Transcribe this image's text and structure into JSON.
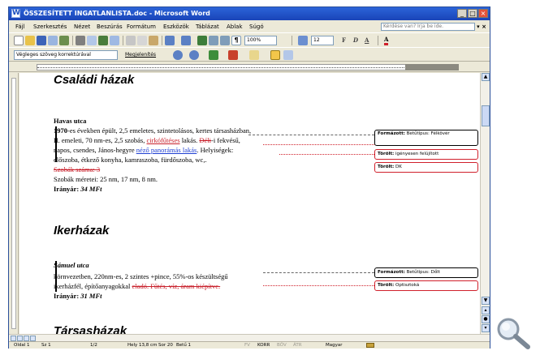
{
  "window": {
    "title": "ÖSSZESÍTETT INGATLANLISTA.doc - Microsoft Word",
    "min": "_",
    "max": "□",
    "close": "×"
  },
  "menu": {
    "items": [
      "Fájl",
      "Szerkesztés",
      "Nézet",
      "Beszúrás",
      "Formátum",
      "Eszközök",
      "Táblázat",
      "Ablak",
      "Súgó"
    ],
    "help_placeholder": "Kérdése van? Írja be ide.",
    "close_doc": "▾ ×"
  },
  "toolbar": {
    "zoom": "100%",
    "font_size": "12",
    "bold": "F",
    "italic": "D",
    "underline": "A",
    "font_color_letter": "A"
  },
  "reviewing": {
    "display_mode": "Végleges szöveg korrektúrával",
    "show_label": "Megjelenítés"
  },
  "document": {
    "heading1": "Családi házak",
    "h1_street": "Havas utca",
    "p1_year": "1970",
    "p1_rest": "-es években épült, 2,5 emeletes, szintetolásos, kertes társasházban,",
    "p2_a": "II. emeleti, 70 nm-es, 2,5 szobás, ",
    "p2_ins": "cirkófűtéses",
    "p2_b": " lakás. ",
    "p2_del": "Déli",
    "p2_c": "-i fekvésű,",
    "p3_a": "napos, csendes, János-hegyre ",
    "p3_link": "néző panorámás lakás",
    "p3_b": ". Helyiségek:",
    "p4": "előszoba, étkező konyha, kamraszoba, fürdőszoba, wc,.",
    "p5_del": "Szobák száma: 3",
    "p6": "Szobák méretei: 25 nm, 17 nm, 8 nm.",
    "p7_label": "Irányár: ",
    "p7_value": "34 MFt",
    "heading2": "Ikerházak",
    "h2_street": "Sámuel utca",
    "q1": "körnvezetben, 220nm-es, 2 szintes +pince, 55%-os készültségű",
    "q2_a": "ikerházfél, építőanyagokkal ",
    "q2_del": "eladó. Fűtés, víz, áram kiépítve.",
    "q3_label": "Irányár: ",
    "q3_value": "31 MFt",
    "heading3": "Társasházak"
  },
  "balloons": [
    {
      "label": "Formázott:",
      "text": "Betűtípus: Félkövér"
    },
    {
      "label": "Törölt:",
      "text": "igényesen felújított"
    },
    {
      "label": "Törölt:",
      "text": "DK"
    },
    {
      "label": "Formázott:",
      "text": "Betűtípus: Dőlt"
    },
    {
      "label": "Törölt:",
      "text": "Optisztoká"
    }
  ],
  "statusbar": {
    "page": "Oldal 1",
    "section": "Sz 1",
    "pages": "1/2",
    "position": "Hely 13,8 cm",
    "line": "Sor 20",
    "col": "Betű 1",
    "rec": "FV",
    "trk": "KORR",
    "ext": "BŐV",
    "ovr": "ÁTR",
    "lang": "Magyar"
  },
  "colors": {
    "title_bar": "#1944b8",
    "revision_red": "#c8202b",
    "link_blue": "#1f3fd2",
    "chrome": "#ece9d8"
  },
  "icons": [
    "magnifier-icon",
    "new-document-icon",
    "open-icon",
    "save-icon",
    "print-icon",
    "spell-check-icon",
    "undo-icon",
    "table-icon",
    "show-formatting-icon",
    "next-change-icon",
    "accept-change-icon",
    "reject-change-icon",
    "track-changes-icon",
    "reviewing-pane-icon"
  ]
}
